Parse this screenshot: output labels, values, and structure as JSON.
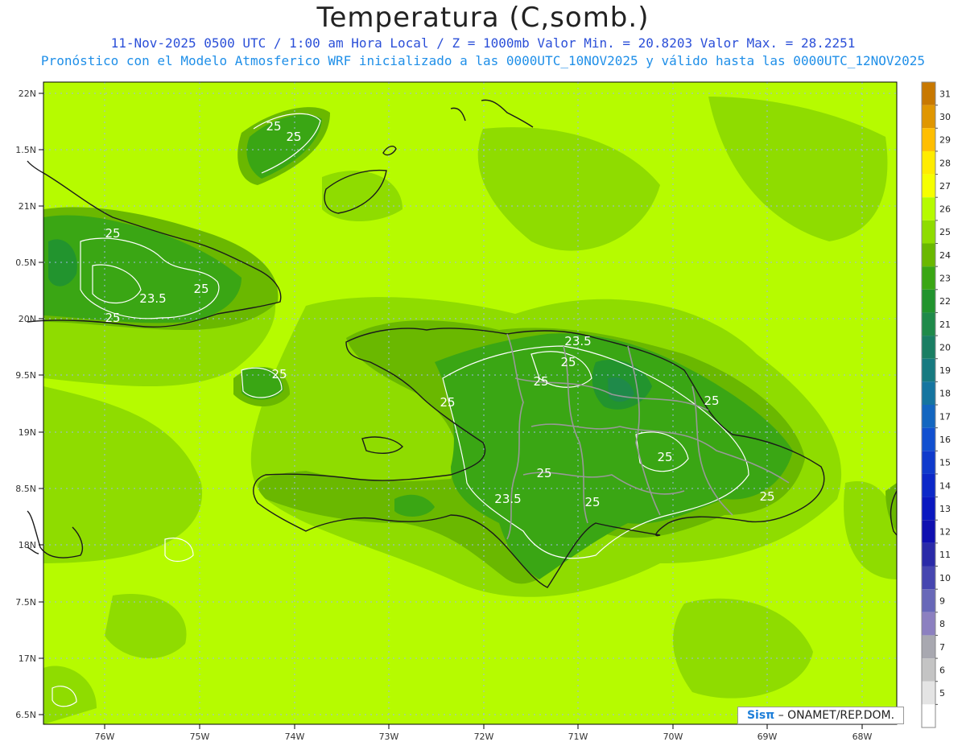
{
  "header": {
    "title": "Temperatura (C,somb.)",
    "subtitle_1": "11-Nov-2025 0500 UTC / 1:00 am Hora Local / Z = 1000mb   Valor Min. = 20.8203  Valor Max. = 28.2251",
    "subtitle_2": "Pronóstico con el Modelo Atmosferico WRF inicializado a las 0000UTC_10NOV2025 y válido hasta las  0000UTC_12NOV2025"
  },
  "colors": {
    "c27": "#b6fb00",
    "c26": "#8fdc00",
    "c25": "#6ab800",
    "c24": "#3aa614",
    "c23": "#22942e",
    "c22": "#1f8a4a",
    "water_line": "#1a1a1a",
    "border": "#999999",
    "contour": "#ffffff",
    "grid": "#9db8e8"
  },
  "map": {
    "lat_labels": [
      "22N",
      "1.5N",
      "21N",
      "0.5N",
      "20N",
      "9.5N",
      "19N",
      "8.5N",
      "18N",
      "7.5N",
      "17N",
      "6.5N"
    ],
    "lon_labels": [
      "76W",
      "75W",
      "74W",
      "73W",
      "72W",
      "71W",
      "70W",
      "69W",
      "68W"
    ],
    "contour_labels": [
      "25",
      "25",
      "25",
      "23.5",
      "25",
      "25",
      "25",
      "23.5",
      "25",
      "25",
      "25",
      "25",
      "25",
      "25",
      "23.5",
      "25",
      "25"
    ]
  },
  "colorbar": {
    "ticks": [
      "31",
      "30",
      "29",
      "28",
      "27",
      "26",
      "25",
      "24",
      "23",
      "22",
      "21",
      "20",
      "19",
      "18",
      "17",
      "16",
      "15",
      "14",
      "13",
      "12",
      "11",
      "10",
      "9",
      "8",
      "7",
      "6",
      "5"
    ],
    "colors": [
      "#c87800",
      "#e09600",
      "#ffbe00",
      "#ffec00",
      "#f6ff00",
      "#b6fb00",
      "#8fdc00",
      "#6ab800",
      "#3aa614",
      "#22942e",
      "#1f8a4a",
      "#1a7e63",
      "#177a80",
      "#1575a0",
      "#1366c0",
      "#1150d0",
      "#0f3acc",
      "#0c28c8",
      "#0a18c0",
      "#1010b0",
      "#2a2aa8",
      "#4646b0",
      "#6868b8",
      "#8c80c0",
      "#a8a8b0",
      "#c4c4c4",
      "#e4e4e4",
      "#ffffff"
    ]
  },
  "credit": {
    "logo": "Sisπ",
    "text": "– ONAMET/REP.DOM."
  }
}
